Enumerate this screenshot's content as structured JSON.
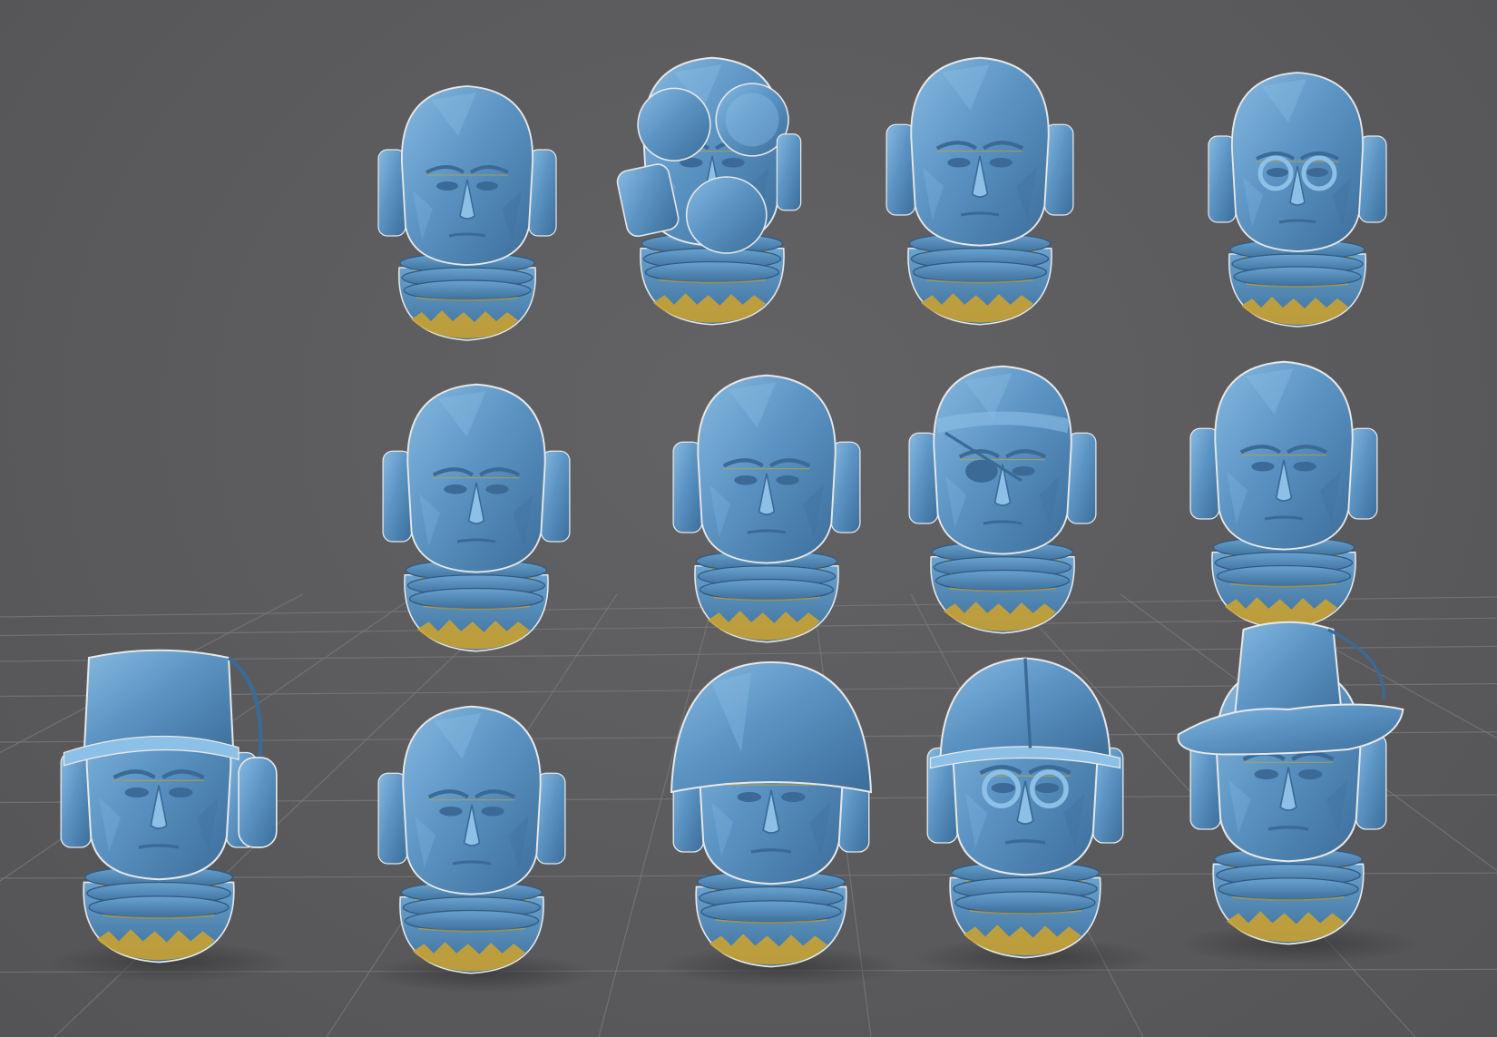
{
  "scene": {
    "background_color": "#5c5c5e",
    "grid_color": "#7a7a7c",
    "model_color": "#5b94c4",
    "model_highlight_color": "#8cc0e6",
    "model_shadow_color": "#3a6a95",
    "support_color": "#c9a232",
    "outline_color": "#e8e8e8"
  },
  "models": [
    {
      "id": "head-1",
      "icon": "bald-head-with-headphones"
    },
    {
      "id": "head-2",
      "icon": "gas-mask-head"
    },
    {
      "id": "head-3",
      "icon": "bald-head-with-headphones"
    },
    {
      "id": "head-4",
      "icon": "goggles-head"
    },
    {
      "id": "head-5",
      "icon": "head-with-headphones"
    },
    {
      "id": "head-6",
      "icon": "head-with-headphones"
    },
    {
      "id": "head-7",
      "icon": "eyepatch-head"
    },
    {
      "id": "head-8",
      "icon": "head-with-headphones"
    },
    {
      "id": "head-9",
      "icon": "cap-and-headset-head"
    },
    {
      "id": "head-10",
      "icon": "bald-head-with-headphones"
    },
    {
      "id": "head-11",
      "icon": "army-helmet-head"
    },
    {
      "id": "head-12",
      "icon": "hard-hat-goggles-head"
    },
    {
      "id": "head-13",
      "icon": "fedora-head"
    }
  ]
}
